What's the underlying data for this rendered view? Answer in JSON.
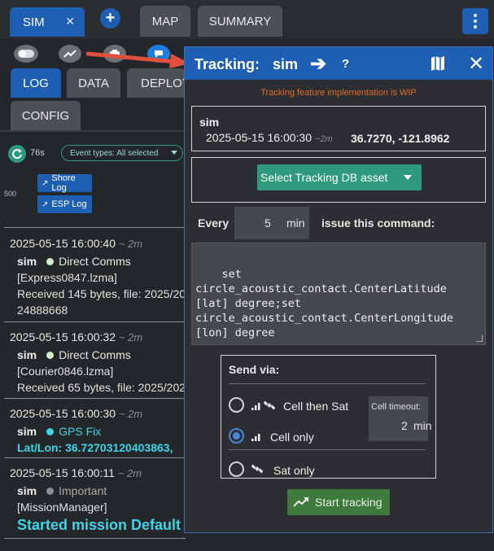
{
  "topbar": {
    "active_tab": "SIM",
    "close_glyph": "✕",
    "add_glyph": "+",
    "tabs": [
      "MAP",
      "SUMMARY"
    ]
  },
  "subtabs": [
    "LOG",
    "DATA",
    "DEPLOY",
    "CONFIG"
  ],
  "log_toolbar": {
    "refresh_label": "76s",
    "event_types": "Event types: All selected",
    "axis_tick": "500",
    "shore_log": "Shore Log",
    "esp_log": "ESP Log"
  },
  "entries": [
    {
      "ts": "2025-05-15 16:00:40",
      "ago": "~ 2m",
      "who": "sim",
      "kind": "Direct Comms",
      "dot": "#d6efc4",
      "lines": [
        "[Express0847.lzma]",
        "Received 145 bytes, file: 2025/20",
        "24888668"
      ]
    },
    {
      "ts": "2025-05-15 16:00:32",
      "ago": "~ 2m",
      "who": "sim",
      "kind": "Direct Comms",
      "dot": "#d6efc4",
      "lines": [
        "[Courier0846.lzma]",
        "Received 65 bytes, file: 2025/202"
      ]
    },
    {
      "ts": "2025-05-15 16:00:30",
      "ago": "~ 2m",
      "who": "sim",
      "kind": "GPS Fix",
      "dot": "#3fd3e6",
      "lines": [
        "Lat/Lon: 36.72703120403863,"
      ]
    },
    {
      "ts": "2025-05-15 16:00:11",
      "ago": "~ 2m",
      "who": "sim",
      "kind": "Important",
      "dot": "#8a8d91",
      "lines": [
        "[MissionManager]"
      ],
      "highlight": "Started mission Default"
    }
  ],
  "dialog": {
    "title": "Tracking:",
    "vehicle": "sim",
    "arrow": "➔",
    "help": "?",
    "close": "✕",
    "wip": "Tracking feature implementation is WIP",
    "summary": {
      "name": "sim",
      "datetime": "2025-05-15 16:00:30",
      "ago": "~2m",
      "coords": "36.7270, -121.8962"
    },
    "select_asset": "Select Tracking DB asset",
    "every_label": "Every",
    "interval_value": "5",
    "interval_unit": "min",
    "issue_label": "issue this command:",
    "command": "set\ncircle_acoustic_contact.CenterLatitude\n[lat] degree;set\ncircle_acoustic_contact.CenterLongitude\n[lon] degree",
    "send_via": "Send via:",
    "options": [
      "Cell then Sat",
      "Cell only",
      "Sat only"
    ],
    "selected_option": "Cell only",
    "cell_timeout_label": "Cell timeout:",
    "cell_timeout_value": "2",
    "cell_timeout_unit": "min",
    "start_button": "Start tracking"
  },
  "colors": {
    "accent": "#1f5fb3",
    "teal": "#2e9a7a",
    "wip": "#e06b2c",
    "start": "#3e7a3c"
  }
}
